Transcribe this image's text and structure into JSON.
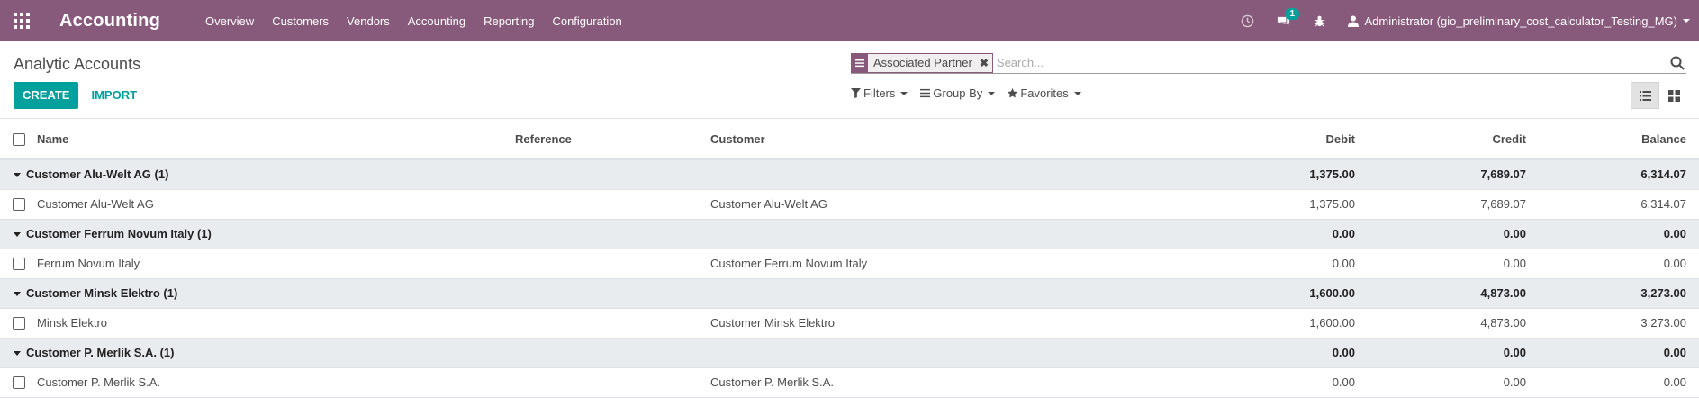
{
  "navbar": {
    "app_title": "Accounting",
    "menu": [
      "Overview",
      "Customers",
      "Vendors",
      "Accounting",
      "Reporting",
      "Configuration"
    ],
    "chat_badge": "1",
    "user_label": "Administrator (gio_preliminary_cost_calculator_Testing_MG)"
  },
  "control": {
    "breadcrumb": "Analytic Accounts",
    "create_label": "CREATE",
    "import_label": "IMPORT",
    "facet_label": "Associated Partner",
    "search_placeholder": "Search...",
    "filters_label": "Filters",
    "groupby_label": "Group By",
    "favorites_label": "Favorites"
  },
  "table": {
    "headers": {
      "name": "Name",
      "reference": "Reference",
      "customer": "Customer",
      "debit": "Debit",
      "credit": "Credit",
      "balance": "Balance"
    },
    "groups": [
      {
        "label": "Customer Alu-Welt AG (1)",
        "debit": "1,375.00",
        "credit": "7,689.07",
        "balance": "6,314.07",
        "row": {
          "name": "Customer Alu-Welt AG",
          "reference": "",
          "customer": "Customer Alu-Welt AG",
          "debit": "1,375.00",
          "credit": "7,689.07",
          "balance": "6,314.07"
        }
      },
      {
        "label": "Customer Ferrum Novum Italy (1)",
        "debit": "0.00",
        "credit": "0.00",
        "balance": "0.00",
        "row": {
          "name": "Ferrum Novum Italy",
          "reference": "",
          "customer": "Customer Ferrum Novum Italy",
          "debit": "0.00",
          "credit": "0.00",
          "balance": "0.00"
        }
      },
      {
        "label": "Customer Minsk Elektro (1)",
        "debit": "1,600.00",
        "credit": "4,873.00",
        "balance": "3,273.00",
        "row": {
          "name": "Minsk Elektro",
          "reference": "",
          "customer": "Customer Minsk Elektro",
          "debit": "1,600.00",
          "credit": "4,873.00",
          "balance": "3,273.00"
        }
      },
      {
        "label": "Customer P. Merlik S.A. (1)",
        "debit": "0.00",
        "credit": "0.00",
        "balance": "0.00",
        "row": {
          "name": "Customer P. Merlik S.A.",
          "reference": "",
          "customer": "Customer P. Merlik S.A.",
          "debit": "0.00",
          "credit": "0.00",
          "balance": "0.00"
        }
      }
    ]
  },
  "colors": {
    "brand": "#875a7b",
    "accent": "#00a09d",
    "group_bg": "#e9ecef"
  }
}
